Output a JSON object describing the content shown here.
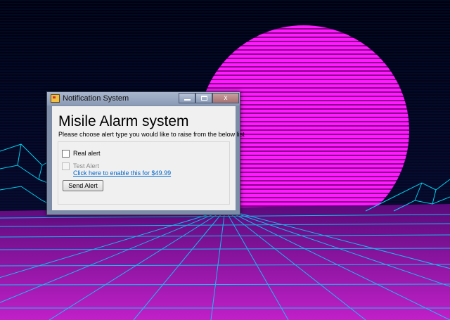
{
  "window": {
    "title": "Notification System",
    "close_symbol": "x"
  },
  "content": {
    "heading": "Misile Alarm system",
    "subheading": "Please choose alert type you would like to raise from the below list",
    "options": [
      {
        "label": "Real alert",
        "checked": false,
        "enabled": true
      },
      {
        "label": "Test Alert",
        "checked": false,
        "enabled": false
      }
    ],
    "enable_link": "Click here to enable this for $49.99",
    "send_button": "Send Alert"
  },
  "colors": {
    "sun": "#ff1aff",
    "grid": "#00e5ff",
    "sky": "#0a0a2e",
    "link": "#0066cc"
  },
  "icons": [
    "app-icon",
    "minimize-icon",
    "maximize-icon",
    "close-icon"
  ]
}
